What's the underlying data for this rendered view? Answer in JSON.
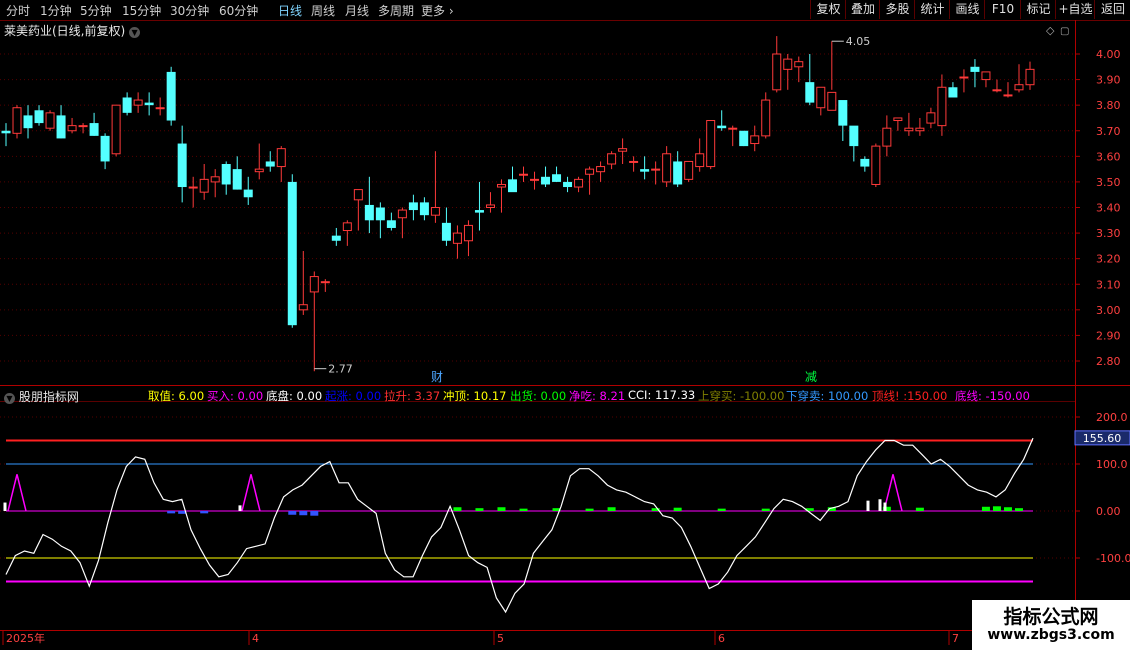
{
  "toolbar": {
    "periods": [
      "分时",
      "1分钟",
      "5分钟",
      "15分钟",
      "30分钟",
      "60分钟",
      "日线",
      "周线",
      "月线",
      "多周期",
      "更多"
    ],
    "active_period": "日线",
    "right_buttons": [
      "复权",
      "叠加",
      "多股",
      "统计",
      "画线",
      "F10",
      "标记",
      "+自选",
      "返回"
    ]
  },
  "stock_title": "莱美药业(日线,前复权)",
  "price_axis_labels": [
    "4.00",
    "3.90",
    "3.80",
    "3.70",
    "3.60",
    "3.50",
    "3.40",
    "3.30",
    "3.20",
    "3.10",
    "3.00",
    "2.90",
    "2.80"
  ],
  "price_annotations": {
    "high": "4.05",
    "low": "2.77"
  },
  "event_markers": [
    "财",
    "减"
  ],
  "indicator": {
    "title": "股朋指标网",
    "values": [
      {
        "label": "取值:",
        "value": "6.00",
        "color": "#ffff00"
      },
      {
        "label": "买入:",
        "value": "0.00",
        "color": "#ff00ff"
      },
      {
        "label": "底盘:",
        "value": "0.00",
        "color": "#ffffff"
      },
      {
        "label": "起涨:",
        "value": "0.00",
        "color": "#0000ff"
      },
      {
        "label": "拉升:",
        "value": "3.37",
        "color": "#ff3030"
      },
      {
        "label": "冲顶:",
        "value": "10.17",
        "color": "#ffff00"
      },
      {
        "label": "出货:",
        "value": "0.00",
        "color": "#00ff00"
      },
      {
        "label": "净吃:",
        "value": "8.21",
        "color": "#ff00ff"
      },
      {
        "label": "CCI:",
        "value": "117.33",
        "color": "#ffffff"
      },
      {
        "label": "上穿买:",
        "value": "-100.00",
        "color": "#808000"
      },
      {
        "label": "下穿卖:",
        "value": "100.00",
        "color": "#3399ff"
      },
      {
        "label": "顶线!",
        "value": ":150.00",
        "color": "#ff2020"
      },
      {
        "label": "底线:",
        "value": "-150.00",
        "color": "#ff00ff"
      }
    ],
    "axis_labels": [
      "200.0",
      "100.0",
      "0.00",
      "-100.0"
    ],
    "current_value": "155.60"
  },
  "date_axis": [
    "2025年",
    "4",
    "5",
    "6",
    "7"
  ],
  "logo": {
    "line1": "指标公式网",
    "line2": "www.zbgs3.com"
  },
  "colors": {
    "up": "#ff3a3a",
    "down": "#54ffff",
    "cci": "#ffffff",
    "top_line": "#ff2020",
    "bottom_line": "#ff00ff",
    "buy_line": "#808000",
    "sell_line": "#3399ff"
  },
  "chart_data": {
    "type": "candlestick",
    "ohlc": [
      [
        3.7,
        3.73,
        3.64,
        3.69
      ],
      [
        3.69,
        3.8,
        3.67,
        3.79
      ],
      [
        3.76,
        3.8,
        3.67,
        3.71
      ],
      [
        3.78,
        3.8,
        3.72,
        3.73
      ],
      [
        3.71,
        3.78,
        3.7,
        3.77
      ],
      [
        3.76,
        3.8,
        3.67,
        3.67
      ],
      [
        3.7,
        3.75,
        3.69,
        3.72
      ],
      [
        3.72,
        3.73,
        3.69,
        3.72
      ],
      [
        3.73,
        3.77,
        3.68,
        3.68
      ],
      [
        3.68,
        3.69,
        3.55,
        3.58
      ],
      [
        3.61,
        3.8,
        3.6,
        3.8
      ],
      [
        3.83,
        3.85,
        3.76,
        3.77
      ],
      [
        3.8,
        3.85,
        3.77,
        3.82
      ],
      [
        3.81,
        3.85,
        3.76,
        3.8
      ],
      [
        3.79,
        3.83,
        3.76,
        3.79
      ],
      [
        3.93,
        3.95,
        3.72,
        3.74
      ],
      [
        3.65,
        3.72,
        3.42,
        3.48
      ],
      [
        3.48,
        3.52,
        3.4,
        3.48
      ],
      [
        3.46,
        3.57,
        3.43,
        3.51
      ],
      [
        3.5,
        3.55,
        3.44,
        3.52
      ],
      [
        3.57,
        3.58,
        3.45,
        3.49
      ],
      [
        3.55,
        3.6,
        3.47,
        3.47
      ],
      [
        3.47,
        3.52,
        3.41,
        3.44
      ],
      [
        3.54,
        3.65,
        3.51,
        3.55
      ],
      [
        3.58,
        3.62,
        3.54,
        3.56
      ],
      [
        3.56,
        3.64,
        3.5,
        3.63
      ],
      [
        3.5,
        3.53,
        2.93,
        2.94
      ],
      [
        3.0,
        3.23,
        2.98,
        3.02
      ],
      [
        3.07,
        3.15,
        2.76,
        3.13
      ],
      [
        3.11,
        3.12,
        3.07,
        3.11
      ],
      [
        3.29,
        3.32,
        3.25,
        3.27
      ],
      [
        3.31,
        3.35,
        3.25,
        3.34
      ],
      [
        3.43,
        3.46,
        3.31,
        3.47
      ],
      [
        3.41,
        3.52,
        3.3,
        3.35
      ],
      [
        3.4,
        3.42,
        3.28,
        3.35
      ],
      [
        3.35,
        3.38,
        3.31,
        3.32
      ],
      [
        3.36,
        3.4,
        3.28,
        3.39
      ],
      [
        3.42,
        3.45,
        3.35,
        3.39
      ],
      [
        3.42,
        3.44,
        3.35,
        3.37
      ],
      [
        3.37,
        3.62,
        3.34,
        3.4
      ],
      [
        3.34,
        3.4,
        3.25,
        3.27
      ],
      [
        3.26,
        3.33,
        3.2,
        3.3
      ],
      [
        3.27,
        3.35,
        3.21,
        3.33
      ],
      [
        3.39,
        3.5,
        3.31,
        3.38
      ],
      [
        3.4,
        3.46,
        3.38,
        3.41
      ],
      [
        3.48,
        3.51,
        3.38,
        3.49
      ],
      [
        3.51,
        3.56,
        3.48,
        3.46
      ],
      [
        3.53,
        3.56,
        3.5,
        3.53
      ],
      [
        3.51,
        3.54,
        3.47,
        3.51
      ],
      [
        3.52,
        3.56,
        3.48,
        3.49
      ],
      [
        3.53,
        3.56,
        3.5,
        3.5
      ],
      [
        3.5,
        3.52,
        3.46,
        3.48
      ],
      [
        3.48,
        3.52,
        3.46,
        3.51
      ],
      [
        3.53,
        3.56,
        3.45,
        3.55
      ],
      [
        3.54,
        3.58,
        3.5,
        3.56
      ],
      [
        3.57,
        3.62,
        3.55,
        3.61
      ],
      [
        3.62,
        3.67,
        3.57,
        3.63
      ],
      [
        3.58,
        3.6,
        3.54,
        3.58
      ],
      [
        3.55,
        3.6,
        3.51,
        3.54
      ],
      [
        3.55,
        3.58,
        3.49,
        3.55
      ],
      [
        3.5,
        3.64,
        3.48,
        3.61
      ],
      [
        3.58,
        3.62,
        3.48,
        3.49
      ],
      [
        3.51,
        3.58,
        3.5,
        3.58
      ],
      [
        3.56,
        3.67,
        3.54,
        3.61
      ],
      [
        3.56,
        3.74,
        3.55,
        3.74
      ],
      [
        3.72,
        3.78,
        3.7,
        3.71
      ],
      [
        3.71,
        3.72,
        3.64,
        3.71
      ],
      [
        3.7,
        3.68,
        3.64,
        3.64
      ],
      [
        3.65,
        3.72,
        3.62,
        3.68
      ],
      [
        3.68,
        3.85,
        3.67,
        3.82
      ],
      [
        3.86,
        4.07,
        3.85,
        4.0
      ],
      [
        3.94,
        4.0,
        3.86,
        3.98
      ],
      [
        3.95,
        3.99,
        3.89,
        3.97
      ],
      [
        3.89,
        4.0,
        3.8,
        3.81
      ],
      [
        3.79,
        3.86,
        3.76,
        3.87
      ],
      [
        3.78,
        4.05,
        3.86,
        3.85
      ],
      [
        3.82,
        3.79,
        3.66,
        3.72
      ],
      [
        3.72,
        3.69,
        3.58,
        3.64
      ],
      [
        3.59,
        3.6,
        3.54,
        3.56
      ],
      [
        3.49,
        3.65,
        3.48,
        3.64
      ],
      [
        3.64,
        3.76,
        3.6,
        3.71
      ],
      [
        3.74,
        3.74,
        3.7,
        3.75
      ],
      [
        3.7,
        3.77,
        3.68,
        3.71
      ],
      [
        3.7,
        3.75,
        3.68,
        3.71
      ],
      [
        3.73,
        3.79,
        3.71,
        3.77
      ],
      [
        3.72,
        3.92,
        3.68,
        3.87
      ],
      [
        3.87,
        3.89,
        3.86,
        3.83
      ],
      [
        3.91,
        3.94,
        3.85,
        3.91
      ],
      [
        3.95,
        3.98,
        3.87,
        3.93
      ],
      [
        3.9,
        3.93,
        3.87,
        3.93
      ],
      [
        3.86,
        3.9,
        3.85,
        3.86
      ],
      [
        3.84,
        3.89,
        3.83,
        3.84
      ],
      [
        3.86,
        3.96,
        3.85,
        3.88
      ],
      [
        3.88,
        3.97,
        3.86,
        3.94
      ]
    ],
    "price_range": [
      2.72,
      4.07
    ],
    "cci": [
      -135,
      -95,
      -85,
      -90,
      -50,
      -60,
      -75,
      -85,
      -110,
      -160,
      -105,
      -25,
      45,
      95,
      115,
      110,
      60,
      25,
      20,
      25,
      -40,
      -80,
      -115,
      -140,
      -135,
      -110,
      -80,
      -75,
      -70,
      -15,
      30,
      45,
      55,
      75,
      95,
      105,
      60,
      60,
      25,
      10,
      -5,
      -90,
      -125,
      -140,
      -140,
      -95,
      -55,
      -35,
      10,
      -40,
      -95,
      -110,
      -120,
      -185,
      -215,
      -175,
      -155,
      -90,
      -65,
      -40,
      10,
      75,
      90,
      90,
      75,
      55,
      45,
      40,
      30,
      20,
      15,
      -10,
      -15,
      -35,
      -75,
      -120,
      -165,
      -155,
      -130,
      -95,
      -75,
      -55,
      -25,
      5,
      25,
      20,
      10,
      -5,
      -20,
      5,
      10,
      20,
      75,
      105,
      130,
      150,
      150,
      140,
      140,
      120,
      100,
      110,
      95,
      75,
      55,
      45,
      40,
      30,
      45,
      80,
      110,
      155
    ],
    "hist": [
      {
        "i": 41,
        "v": 8,
        "c": "#00ff00"
      },
      {
        "i": 43,
        "v": 6,
        "c": "#00ff00"
      },
      {
        "i": 45,
        "v": 8,
        "c": "#00ff00"
      },
      {
        "i": 47,
        "v": 5,
        "c": "#00ff00"
      },
      {
        "i": 50,
        "v": 6,
        "c": "#00ff00"
      },
      {
        "i": 53,
        "v": 5,
        "c": "#00ff00"
      },
      {
        "i": 55,
        "v": 8,
        "c": "#00ff00"
      },
      {
        "i": 59,
        "v": 6,
        "c": "#00ff00"
      },
      {
        "i": 61,
        "v": 7,
        "c": "#00ff00"
      },
      {
        "i": 65,
        "v": 5,
        "c": "#00ff00"
      },
      {
        "i": 69,
        "v": 5,
        "c": "#00ff00"
      },
      {
        "i": 73,
        "v": 6,
        "c": "#00ff00"
      },
      {
        "i": 75,
        "v": 8,
        "c": "#00ff00"
      },
      {
        "i": 80,
        "v": 9,
        "c": "#00ff00"
      },
      {
        "i": 83,
        "v": 7,
        "c": "#00ff00"
      },
      {
        "i": 89,
        "v": 9,
        "c": "#00ff00"
      },
      {
        "i": 90,
        "v": 10,
        "c": "#00ff00"
      },
      {
        "i": 91,
        "v": 8,
        "c": "#00ff00"
      },
      {
        "i": 92,
        "v": 6,
        "c": "#00ff00"
      },
      {
        "i": 15,
        "v": -5,
        "c": "#3355ff"
      },
      {
        "i": 16,
        "v": -6,
        "c": "#3355ff"
      },
      {
        "i": 18,
        "v": -5,
        "c": "#3355ff"
      },
      {
        "i": 26,
        "v": -8,
        "c": "#3355ff"
      },
      {
        "i": 27,
        "v": -9,
        "c": "#3355ff"
      },
      {
        "i": 28,
        "v": -10,
        "c": "#3355ff"
      }
    ]
  }
}
